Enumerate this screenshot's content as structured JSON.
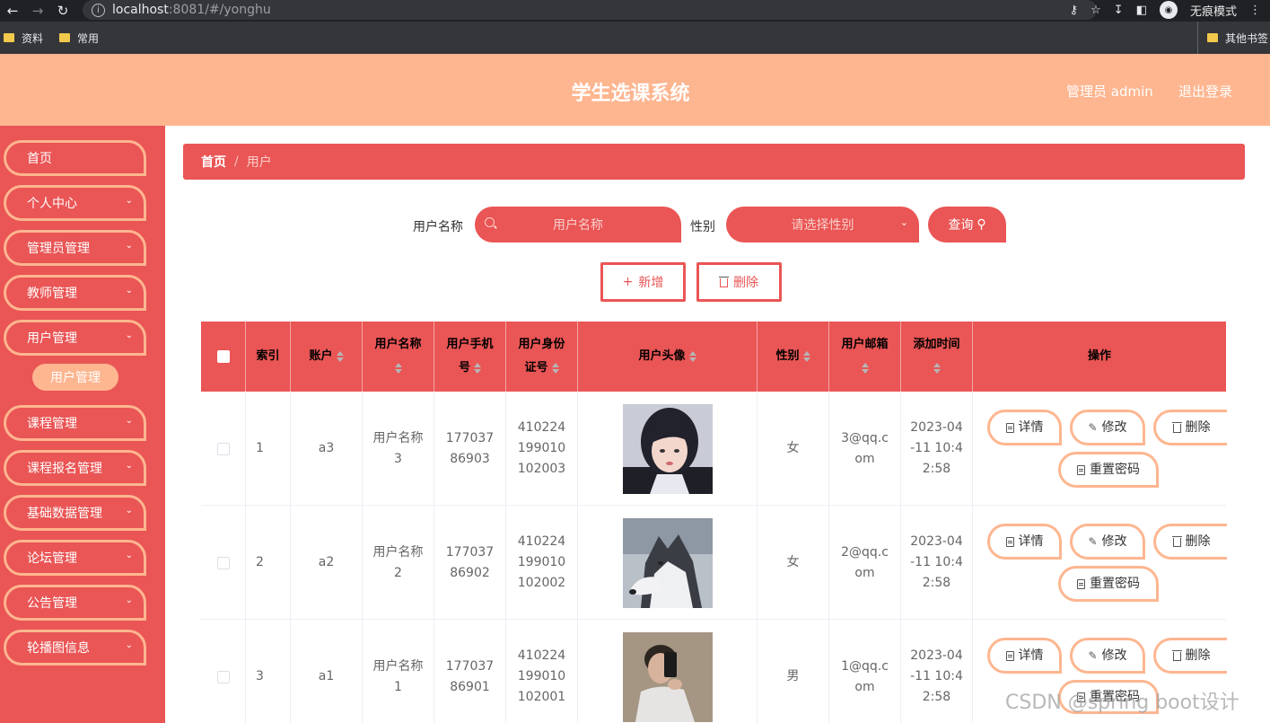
{
  "browser": {
    "url_host": "localhost",
    "url_path": ":8081/#/yonghu",
    "incognito_label": "无痕模式",
    "bookmarks": [
      "资料",
      "常用"
    ],
    "other_bookmarks": "其他书签"
  },
  "header": {
    "title": "学生选课系统",
    "user": "管理员 admin",
    "logout": "退出登录"
  },
  "sidebar": {
    "items": [
      {
        "label": "首页",
        "has_arrow": false
      },
      {
        "label": "个人中心",
        "has_arrow": true
      },
      {
        "label": "管理员管理",
        "has_arrow": true
      },
      {
        "label": "教师管理",
        "has_arrow": true
      },
      {
        "label": "用户管理",
        "has_arrow": true
      },
      {
        "label": "课程管理",
        "has_arrow": true
      },
      {
        "label": "课程报名管理",
        "has_arrow": true
      },
      {
        "label": "基础数据管理",
        "has_arrow": true
      },
      {
        "label": "论坛管理",
        "has_arrow": true
      },
      {
        "label": "公告管理",
        "has_arrow": true
      },
      {
        "label": "轮播图信息",
        "has_arrow": true
      }
    ],
    "active_sub": "用户管理"
  },
  "breadcrumb": {
    "home": "首页",
    "separator": "/",
    "current": "用户"
  },
  "search": {
    "name_label": "用户名称",
    "name_placeholder": "用户名称",
    "gender_label": "性别",
    "gender_placeholder": "请选择性别",
    "query_button": "查询"
  },
  "actions": {
    "add": "新增",
    "delete": "删除"
  },
  "table": {
    "columns": [
      "索引",
      "账户",
      "用户名称",
      "用户手机号",
      "用户身份证号",
      "用户头像",
      "性别",
      "用户邮箱",
      "添加时间",
      "操作"
    ],
    "rows": [
      {
        "index": "1",
        "account": "a3",
        "name": "用户名称3",
        "phone": "17703786903",
        "idcard": "410224199010102003",
        "avatar": "girl-portrait",
        "gender": "女",
        "email": "3@qq.com",
        "time": "2023-04-11 10:42:58"
      },
      {
        "index": "2",
        "account": "a2",
        "name": "用户名称2",
        "phone": "17703786902",
        "idcard": "410224199010102002",
        "avatar": "husky-dog",
        "gender": "女",
        "email": "2@qq.com",
        "time": "2023-04-11 10:42:58"
      },
      {
        "index": "3",
        "account": "a1",
        "name": "用户名称1",
        "phone": "17703786901",
        "idcard": "410224199010102001",
        "avatar": "boy-selfie",
        "gender": "男",
        "email": "1@qq.com",
        "time": "2023-04-11 10:42:58"
      }
    ],
    "row_actions": {
      "detail": "详情",
      "edit": "修改",
      "delete": "删除",
      "reset_password": "重置密码"
    }
  },
  "watermark": "CSDN @spring boot设计",
  "colors": {
    "primary": "#ea5555",
    "accent": "#feb690",
    "header": "#feb690"
  }
}
